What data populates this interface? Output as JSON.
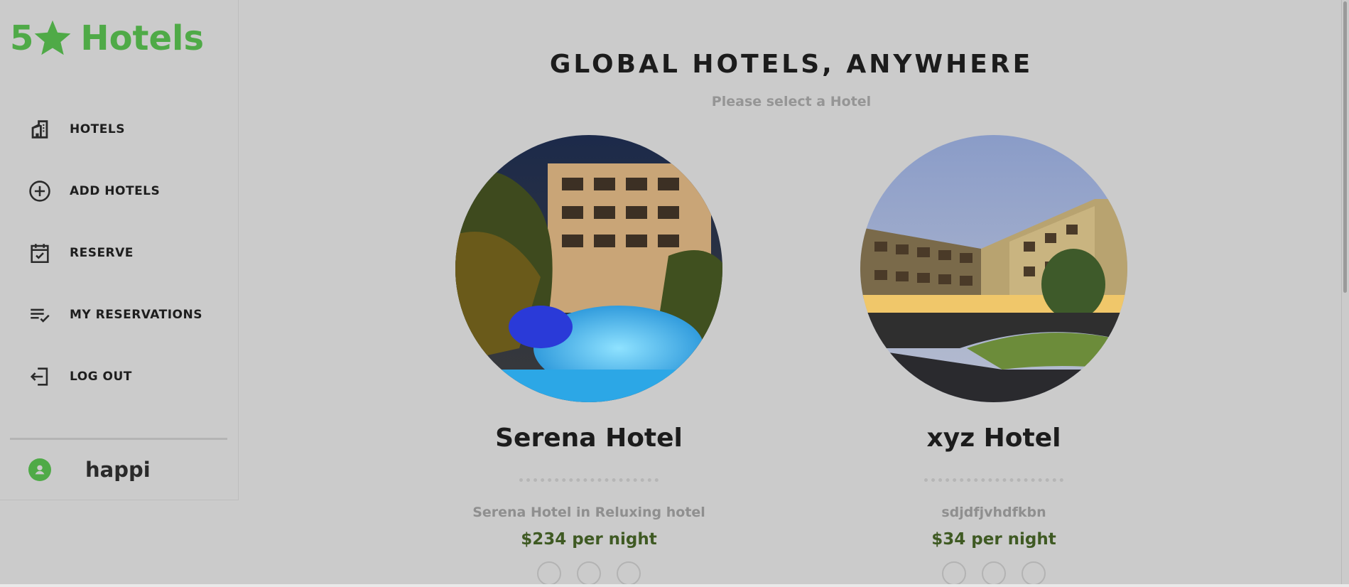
{
  "brand": {
    "prefix": "5",
    "word": "Hotels",
    "color": "#4faa47",
    "icon": "star-icon"
  },
  "nav": [
    {
      "label": "HOTELS",
      "icon": "building-icon"
    },
    {
      "label": "ADD HOTELS",
      "icon": "plus-circle-icon"
    },
    {
      "label": "RESERVE",
      "icon": "calendar-check-icon"
    },
    {
      "label": "MY RESERVATIONS",
      "icon": "list-check-icon"
    },
    {
      "label": "LOG OUT",
      "icon": "logout-icon"
    }
  ],
  "user": {
    "name": "happi",
    "icon": "user-avatar-icon"
  },
  "main": {
    "title": "GLOBAL HOTELS, ANYWHERE",
    "subtitle": "Please select a Hotel"
  },
  "hotels": [
    {
      "name": "Serena Hotel",
      "description": "Serena Hotel in Reluxing hotel",
      "price": "$234 per night"
    },
    {
      "name": "xyz Hotel",
      "description": "sdjdfjvhdfkbn",
      "price": "$34 per night"
    }
  ],
  "colors": {
    "accent": "#4faa47",
    "price": "#3f5a23",
    "background": "#cbcbcb"
  }
}
